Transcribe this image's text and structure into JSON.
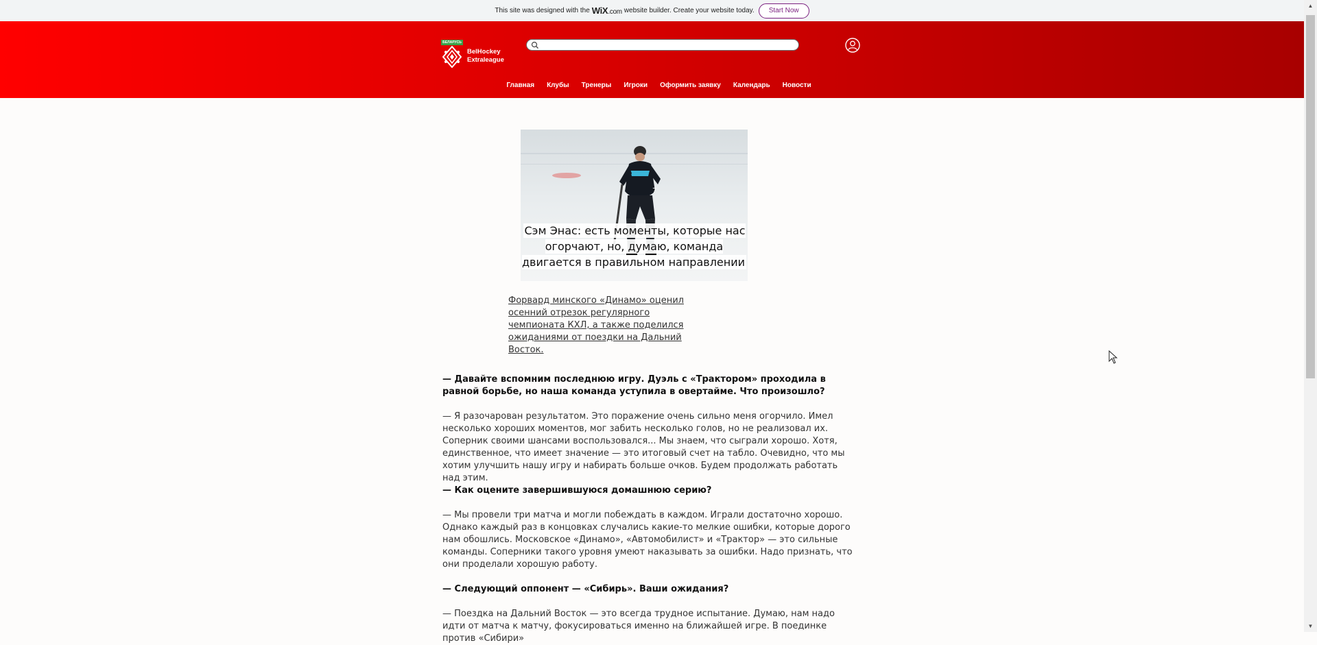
{
  "wix_banner": {
    "text_before": "This site was designed with the",
    "brand": "WiX",
    "brand_suffix": ".com",
    "text_after": "website builder. Create your website today.",
    "button": "Start Now"
  },
  "header": {
    "logo_flag_text": "БЕЛАРУСЬ",
    "logo_line1": "BelHockey",
    "logo_line2": "Extraleague",
    "search_placeholder": "",
    "nav": [
      "Главная",
      "Клубы",
      "Тренеры",
      "Игроки",
      "Оформить заявку",
      "Календарь",
      "Новости"
    ]
  },
  "article": {
    "hero_title": "Сэм Энас: есть моменты, которые нас огорчают, но, думаю, команда двигается в правильном направлении",
    "lead": "Форвард минского «Динамо» оценил осенний отрезок регулярного чемпионата КХЛ, а также поделился ожиданиями от поездки на Дальний Восток.",
    "q1": "— Давайте вспомним последнюю игру. Дуэль с «Трактором» проходила в равной борьбе, но наша команда уступила в овертайме. Что произошло?",
    "a1": "— Я разочарован результатом. Это поражение очень сильно меня огорчило. Имел несколько хороших моментов, мог забить несколько голов, но не реализовал их. Соперник своими шансами воспользовался... Мы знаем, что сыграли хорошо. Хотя, единственное, что имеет значение — это итоговый счет на табло. Очевидно, что мы хотим улучшить нашу игру и набирать больше очков. Будем продолжать работать над этим.",
    "q2": "— Как оцените завершившуюся домашнюю серию?",
    "a2": "— Мы провели три матча и могли побеждать в каждом. Играли достаточно хорошо. Однако каждый раз в концовках случались какие-то мелкие ошибки, которые дорого нам обошлись. Московское «Динамо», «Автомобилист» и «Трактор» — это сильные команды. Соперники такого уровня умеют наказывать за ошибки. Надо признать, что они проделали хорошую работу.",
    "q3": "— Следующий оппонент — «Сибирь». Ваши ожидания?",
    "a3": "— Поездка на Дальний Восток — это всегда трудное испытание. Думаю, нам надо идти от матча к матчу, фокусироваться именно на ближайшей игре. В поединке против «Сибири»"
  }
}
